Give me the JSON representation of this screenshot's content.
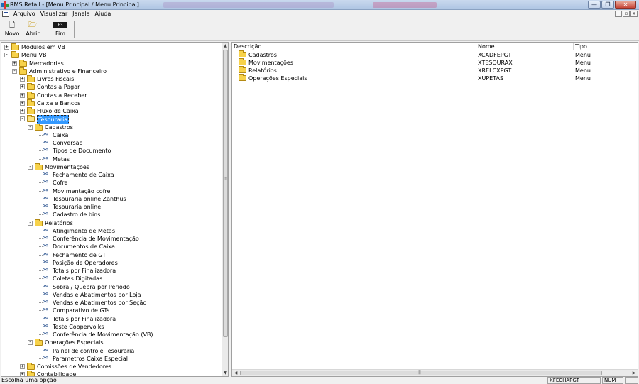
{
  "window": {
    "title": "RMS Retail - [Menu Principal / Menu Principal]",
    "minimize": "—",
    "maximize": "❐",
    "close": "✕"
  },
  "menu": {
    "items": [
      "Arquivo",
      "Visualizar",
      "Janela",
      "Ajuda"
    ],
    "mdi_min": "_",
    "mdi_max": "▫",
    "mdi_close": "x"
  },
  "toolbar": {
    "novo": "Novo",
    "abrir": "Abrir",
    "fim": "Fim",
    "fim_key": "F3"
  },
  "tree": {
    "nodes": [
      {
        "label": "Modulos em VB",
        "icon": "folder-icon",
        "expander": "+"
      },
      {
        "label": "Menu VB",
        "icon": "folder-icon",
        "expander": "-"
      },
      {
        "label": "Mercadorias",
        "icon": "folder-icon",
        "expander": "+"
      },
      {
        "label": "Administrativo e Financeiro",
        "icon": "folder-icon",
        "expander": "-"
      },
      {
        "label": "Livros Fiscais",
        "icon": "folder-icon",
        "expander": "+"
      },
      {
        "label": "Contas a Pagar",
        "icon": "folder-icon",
        "expander": "+"
      },
      {
        "label": "Contas a Receber",
        "icon": "folder-icon",
        "expander": "+"
      },
      {
        "label": "Caixa e Bancos",
        "icon": "folder-icon",
        "expander": "+"
      },
      {
        "label": "Fluxo de Caixa",
        "icon": "folder-icon",
        "expander": "+"
      },
      {
        "label": "Tesouraria",
        "icon": "open-folder-icon",
        "expander": "-",
        "selected": true
      },
      {
        "label": "Cadastros",
        "icon": "folder-icon",
        "expander": "-"
      },
      {
        "label": "Caixa",
        "icon": "program-icon"
      },
      {
        "label": "Conversão",
        "icon": "program-icon"
      },
      {
        "label": "Tipos de Documento",
        "icon": "program-icon"
      },
      {
        "label": "Metas",
        "icon": "program-icon"
      },
      {
        "label": "Movimentações",
        "icon": "folder-icon",
        "expander": "-"
      },
      {
        "label": "Fechamento de Caixa",
        "icon": "program-icon"
      },
      {
        "label": "Cofre",
        "icon": "program-icon"
      },
      {
        "label": "Movimentação cofre",
        "icon": "program-icon"
      },
      {
        "label": "Tesouraria online Zanthus",
        "icon": "program-icon"
      },
      {
        "label": "Tesouraria online",
        "icon": "program-icon"
      },
      {
        "label": "Cadastro de bins",
        "icon": "program-icon"
      },
      {
        "label": "Relatórios",
        "icon": "folder-icon",
        "expander": "-"
      },
      {
        "label": "Atingimento de Metas",
        "icon": "program-icon"
      },
      {
        "label": "Conferência de Movimentação",
        "icon": "program-icon"
      },
      {
        "label": "Documentos de Caixa",
        "icon": "program-icon"
      },
      {
        "label": "Fechamento de GT",
        "icon": "program-icon"
      },
      {
        "label": "Posição de Operadores",
        "icon": "program-icon"
      },
      {
        "label": "Totais por Finalizadora",
        "icon": "program-icon"
      },
      {
        "label": "Coletas Digitadas",
        "icon": "program-icon"
      },
      {
        "label": "Sobra / Quebra por Periodo",
        "icon": "program-icon"
      },
      {
        "label": "Vendas e Abatimentos por Loja",
        "icon": "program-icon"
      },
      {
        "label": "Vendas e Abatimentos por Seção",
        "icon": "program-icon"
      },
      {
        "label": "Comparativo de GTs",
        "icon": "program-icon"
      },
      {
        "label": "Totais por Finalizadora",
        "icon": "program-icon"
      },
      {
        "label": "Teste Coopervolks",
        "icon": "program-icon"
      },
      {
        "label": "Conferência de Movimentação (VB)",
        "icon": "program-icon"
      },
      {
        "label": "Operações Especiais",
        "icon": "folder-icon",
        "expander": "-"
      },
      {
        "label": "Painel de controle Tesouraria",
        "icon": "program-icon"
      },
      {
        "label": "Parametros Caixa Especial",
        "icon": "program-icon"
      },
      {
        "label": "Comissões de Vendedores",
        "icon": "folder-icon",
        "expander": "+"
      },
      {
        "label": "Contabilidade",
        "icon": "folder-icon",
        "expander": "+"
      }
    ]
  },
  "list": {
    "columns": [
      "Descrição",
      "Nome",
      "Tipo"
    ],
    "rows": [
      {
        "descricao": "Cadastros",
        "nome": "XCADFEPGT",
        "tipo": "Menu"
      },
      {
        "descricao": "Movimentações",
        "nome": "XTESOURAX",
        "tipo": "Menu"
      },
      {
        "descricao": "Relatórios",
        "nome": "XRELCXPGT",
        "tipo": "Menu"
      },
      {
        "descricao": "Operações Especiais",
        "nome": "XUPETAS",
        "tipo": "Menu"
      }
    ]
  },
  "status": {
    "message": "Escolha uma opção",
    "program": "XFECHAPGT",
    "num": "NUM"
  },
  "colors": {
    "selection": "#3399ff",
    "folder": "#f7d24a"
  }
}
